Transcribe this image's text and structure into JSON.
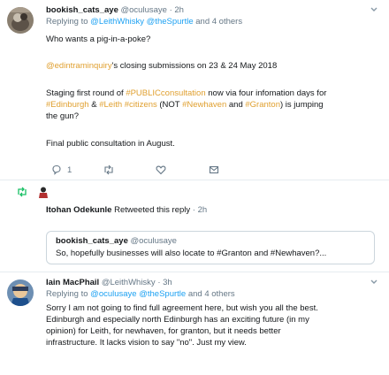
{
  "tweet1": {
    "name": "bookish_cats_aye",
    "handle": "@oculusaye",
    "time": "· 2h",
    "replying_prefix": "Replying to",
    "replying_to": "@LeithWhisky @theSpurtle",
    "replying_suffix": "and 4 others",
    "line1": "Who wants a pig-in-a-poke?",
    "line2_mention": "@edintraminquiry",
    "line2_rest": "'s closing submissions on 23 & 24 May 2018",
    "line3a": "Staging first round of",
    "line3_tag": "#PUBLICconsultation",
    "line3b": "now via four infomation days for",
    "line4_tag1": "#Edinburgh",
    "line4_amp": "&",
    "line4_tag2": "#Leith",
    "line4_tag3": "#citizens",
    "line4_not": "(NOT",
    "line4_tag4": "#Newhaven",
    "line4_and": "and",
    "line4_tag5": "#Granton",
    "line4_rest": ") is jumping",
    "line5": "the gun?",
    "line6": "Final public consultation in August.",
    "reply_count": "1",
    "icons": {
      "reply": "reply-icon",
      "retweet": "retweet-icon",
      "like": "heart-icon",
      "dm": "envelope-icon"
    }
  },
  "retweet": {
    "text_name": "Itohan Odekunle",
    "text_rest": "Retweeted this reply",
    "time": "· 2h",
    "quote_name": "bookish_cats_aye",
    "quote_handle": "@oculusaye",
    "quote_text": "So, hopefully businesses will also locate to #Granton and #Newhaven?..."
  },
  "tweet2": {
    "name": "Iain MacPhail",
    "handle": "@LeithWhisky",
    "time": "· 3h",
    "replying_prefix": "Replying to",
    "replying_to": "@oculusaye @theSpurtle",
    "replying_suffix": "and 4 others",
    "line1": "Sorry I am not going to find full agreement here, but wish you all the best.",
    "line2": "Edinburgh and especially north Edinburgh has an exciting future (in my",
    "line3": "opinion) for Leith, for newhaven, for granton, but it needs better",
    "line4": "infrastructure. It lacks vision to say \"no\". Just my view."
  },
  "colors": {
    "link": "#1da1f2",
    "muted": "#657786",
    "retweet_green": "#17bf63",
    "hashtag_amber": "#e0a030"
  }
}
